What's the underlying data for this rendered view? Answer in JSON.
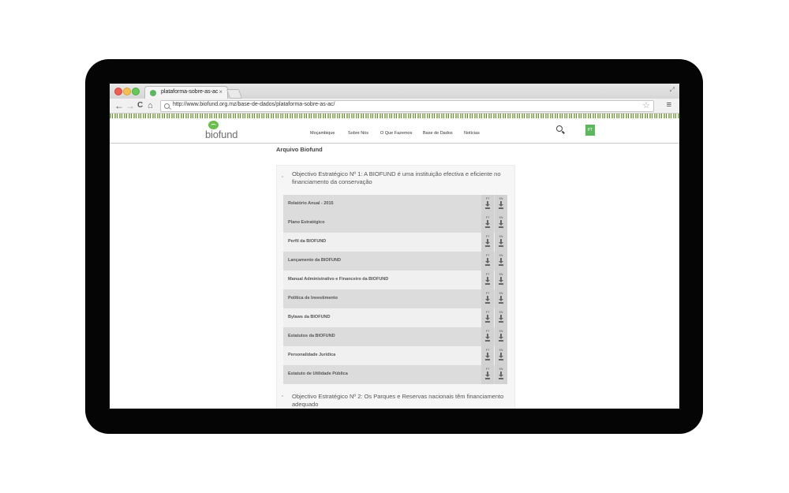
{
  "browser": {
    "tab_title": "plataforma-sobre-as-ac",
    "tab_close": "×",
    "url": "http://www.biofund.org.mz/base-de-dados/plataforma-sobre-as-ac/",
    "back": "←",
    "forward": "→",
    "reload": "C",
    "home": "⌂",
    "bookmark": "☆",
    "menu": "≡",
    "expand": "⤢"
  },
  "site": {
    "logo_text": "biofund",
    "nav": [
      "Moçambique",
      "Sobre Nós",
      "O Que Fazemos",
      "Base de Dados",
      "Notícias"
    ],
    "language": "PT",
    "page_title": "Arquivo Biofund"
  },
  "accordion": [
    {
      "chevron": "ˆ",
      "title": "Objectivo Estratégico Nº 1: A BIOFUND é uma instituição efectiva e eficiente no financiamento da conservação",
      "expanded": true
    },
    {
      "chevron": "ˇ",
      "title": "Objectivo Estratégico Nº 2: Os Parques e Reservas nacionais têm financiamento adequado",
      "expanded": false
    }
  ],
  "documents": [
    {
      "name": "Relatório Anual - 2015"
    },
    {
      "name": "Plano Estratégico"
    },
    {
      "name": "Perfil da BIOFUND"
    },
    {
      "name": "Lançamento da BIOFUND"
    },
    {
      "name": "Manual Administrativo e Financeiro da BIOFUND"
    },
    {
      "name": "Política de Investimento"
    },
    {
      "name": "Bylaws da BIOFUND"
    },
    {
      "name": "Estatutos da BIOFUND"
    },
    {
      "name": "Personalidade Jurídica"
    },
    {
      "name": "Estatuto de Utilidade Pública"
    }
  ],
  "download_labels": {
    "pt": "PT",
    "en": "EN"
  },
  "colors": {
    "brand_green": "#6abf4b",
    "row_dark": "#dcdcdc",
    "row_light": "#f0f0f0"
  }
}
